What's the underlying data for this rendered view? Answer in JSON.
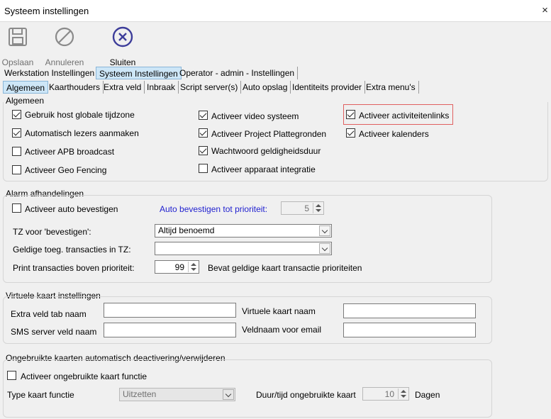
{
  "window": {
    "title": "Systeem instellingen",
    "close_glyph": "×"
  },
  "toolbar": {
    "save_label": "Opslaan",
    "cancel_label": "Annuleren",
    "close_label": "Sluiten",
    "close_color": "#3d3d9a"
  },
  "tabs_top": [
    "Werkstation Instellingen",
    "Systeem Instellingen",
    "Operator - admin - Instellingen"
  ],
  "tabs_sub": [
    "Algemeen",
    "Kaarthouders",
    "Extra veld",
    "Inbraak",
    "Script server(s)",
    "Auto opslag",
    "Identiteits provider",
    "Extra menu's"
  ],
  "algemeen": {
    "title": "Algemeen",
    "col1": [
      {
        "label": "Gebruik host globale tijdzone",
        "checked": true
      },
      {
        "label": "Automatisch lezers aanmaken",
        "checked": true
      },
      {
        "label": "Activeer APB broadcast",
        "checked": false
      },
      {
        "label": "Activeer Geo Fencing",
        "checked": false
      }
    ],
    "col2": [
      {
        "label": "Activeer video systeem",
        "checked": true
      },
      {
        "label": "Activeer Project Plattegronden",
        "checked": true
      },
      {
        "label": "Wachtwoord geldigheidsduur",
        "checked": true
      },
      {
        "label": "Activeer apparaat integratie",
        "checked": false
      }
    ],
    "col3": [
      {
        "label": "Activeer activiteitenlinks",
        "checked": true
      },
      {
        "label": "Activeer kalenders",
        "checked": true
      }
    ]
  },
  "alarm": {
    "title": "Alarm afhandelingen",
    "auto_confirm_label": "Activeer auto bevestigen",
    "auto_confirm_checked": false,
    "auto_prio_label": "Auto bevestigen tot prioriteit:",
    "auto_prio_value": "5",
    "tz_label": "TZ voor 'bevestigen':",
    "tz_value": "Altijd benoemd",
    "valid_tx_label": "Geldige toeg. transacties in TZ:",
    "valid_tx_value": "",
    "print_label": "Print transacties boven prioriteit:",
    "print_value": "99",
    "print_note": "Bevat geldige kaart transactie prioriteiten"
  },
  "virtual": {
    "title": "Virtuele kaart instellingen",
    "extra_tab_label": "Extra veld tab naam",
    "extra_tab_value": "",
    "sms_label": "SMS server veld naam",
    "sms_value": "",
    "card_name_label": "Virtuele kaart naam",
    "card_name_value": "",
    "email_label": "Veldnaam voor email",
    "email_value": ""
  },
  "unused": {
    "title": "Ongebruikte kaarten automatisch deactivering/verwijderen",
    "activate_label": "Activeer ongebruikte kaart functie",
    "activate_checked": false,
    "type_label": "Type kaart functie",
    "type_value": "Uitzetten",
    "duration_label": "Duur/tijd ongebruikte kaart",
    "duration_value": "10",
    "days_label": "Dagen"
  }
}
